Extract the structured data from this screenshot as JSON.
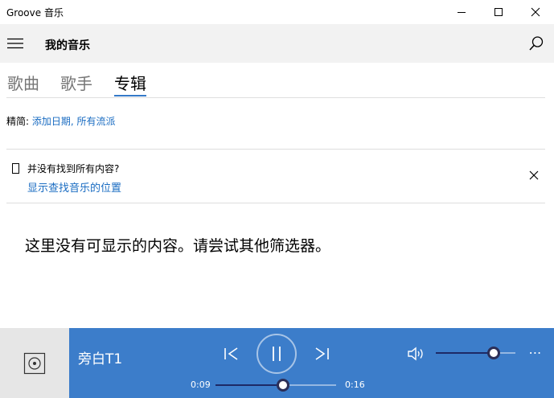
{
  "window": {
    "title": "Groove 音乐"
  },
  "header": {
    "title": "我的音乐"
  },
  "tabs": [
    {
      "label": "歌曲",
      "active": false
    },
    {
      "label": "歌手",
      "active": false
    },
    {
      "label": "专辑",
      "active": true
    }
  ],
  "filter": {
    "prefix": "精简: ",
    "value": "添加日期, 所有流派"
  },
  "notice": {
    "question": "并没有找到所有内容?",
    "link": "显示查找音乐的位置"
  },
  "empty_message": "这里没有可显示的内容。请尝试其他筛选器。",
  "player": {
    "track_title": "旁白T1",
    "elapsed": "0:09",
    "total": "0:16",
    "progress_fraction": 0.56,
    "volume_fraction": 0.73,
    "more_label": "⋯",
    "state": "playing"
  },
  "colors": {
    "accent": "#3c7dca",
    "link": "#1a6cc2",
    "header_bg": "#f2f2f2"
  }
}
